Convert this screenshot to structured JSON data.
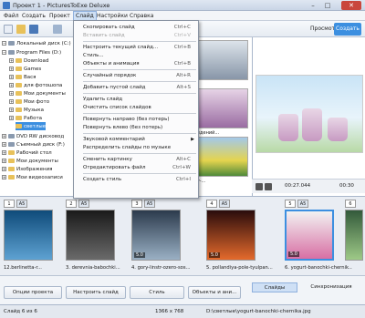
{
  "window": {
    "title": "Проект 1 - PicturesToExe Deluxe",
    "minimize": "–",
    "maximize": "□",
    "close": "✕"
  },
  "menubar": [
    {
      "label": "Файл"
    },
    {
      "label": "Создать"
    },
    {
      "label": "Проект"
    },
    {
      "label": "Слайд"
    },
    {
      "label": "Настройки"
    },
    {
      "label": "Справка"
    }
  ],
  "toolbar": {
    "preview_label": "Просмотр",
    "create_label": "Создать"
  },
  "tree": [
    {
      "label": "Локальный диск (C:)",
      "exp": "−",
      "type": "drive"
    },
    {
      "label": "Program Files (D:)",
      "exp": "−",
      "type": "drive"
    },
    {
      "label": "Download",
      "exp": "+",
      "type": "folder"
    },
    {
      "label": "Games",
      "exp": "+",
      "type": "folder"
    },
    {
      "label": "Вася",
      "exp": "+",
      "type": "folder"
    },
    {
      "label": "для фотошопа",
      "exp": "+",
      "type": "folder"
    },
    {
      "label": "Мои документы",
      "exp": "+",
      "type": "folder"
    },
    {
      "label": "Мои фото",
      "exp": "+",
      "type": "folder"
    },
    {
      "label": "Музыка",
      "exp": "+",
      "type": "folder"
    },
    {
      "label": "Работа",
      "exp": "+",
      "type": "folder"
    },
    {
      "label": "светлые",
      "exp": "",
      "type": "folder",
      "selected": true
    },
    {
      "label": "DVD RW дисковод",
      "exp": "+",
      "type": "drive"
    },
    {
      "label": "Съемный диск (F:)",
      "exp": "+",
      "type": "drive"
    },
    {
      "label": "Рабочий стол",
      "exp": "+",
      "type": "folder"
    },
    {
      "label": "Мои документы",
      "exp": "+",
      "type": "folder"
    },
    {
      "label": "Изображения",
      "exp": "+",
      "type": "folder"
    },
    {
      "label": "Мои видеозаписи",
      "exp": "+",
      "type": "folder"
    }
  ],
  "top_thumbs": [
    {
      "caption": "fdk..."
    },
    {
      "caption": "...ых сведений..."
    },
    {
      "caption": "tyulpany-...",
      "tooltip": "tyulpany-"
    }
  ],
  "player": {
    "time_current": "00:27.044",
    "time_total": "00:30"
  },
  "dropdown": {
    "items": [
      {
        "label": "Скопировать слайд",
        "shortcut": "Ctrl+C",
        "disabled": false
      },
      {
        "label": "Вставить слайд",
        "shortcut": "Ctrl+V",
        "disabled": true
      },
      {
        "sep": true
      },
      {
        "label": "Настроить текущий слайд...",
        "shortcut": "Ctrl+B",
        "disabled": false
      },
      {
        "label": "Стиль...",
        "shortcut": "",
        "disabled": false
      },
      {
        "label": "Объекты и анимация",
        "shortcut": "Ctrl+B",
        "disabled": false
      },
      {
        "sep": true
      },
      {
        "label": "Случайный порядок",
        "shortcut": "Alt+R",
        "disabled": false
      },
      {
        "sep": true
      },
      {
        "label": "Добавить пустой слайд",
        "shortcut": "Alt+S",
        "disabled": false
      },
      {
        "sep": true
      },
      {
        "label": "Удалить слайд",
        "shortcut": "",
        "disabled": false
      },
      {
        "label": "Очистить список слайдов",
        "shortcut": "",
        "disabled": false
      },
      {
        "sep": true
      },
      {
        "label": "Повернуть направо (без потерь)",
        "shortcut": "",
        "disabled": false
      },
      {
        "label": "Повернуть влево (без потерь)",
        "shortcut": "",
        "disabled": false
      },
      {
        "sep": true
      },
      {
        "label": "Звуковой комментарий",
        "shortcut": "",
        "disabled": false,
        "submenu": true
      },
      {
        "label": "Распределить слайды по музыке",
        "shortcut": "",
        "disabled": false
      },
      {
        "sep": true
      },
      {
        "label": "Сменить картинку",
        "shortcut": "Alt+C",
        "disabled": false
      },
      {
        "label": "Отредактировать файл",
        "shortcut": "Ctrl+W",
        "disabled": false
      },
      {
        "sep": true
      },
      {
        "label": "Создать стиль",
        "shortcut": "Ctrl+I",
        "disabled": false
      }
    ]
  },
  "slides": [
    {
      "num": "1",
      "duration": "A5",
      "caption": "12.berlinetta-r...",
      "badge": "",
      "colors": [
        "#0f4b7a",
        "#5ea2d2"
      ]
    },
    {
      "num": "2",
      "duration": "A5",
      "caption": "3. derevnia-babochki...",
      "badge": "",
      "colors": [
        "#1a1a1a",
        "#6a6a6a"
      ]
    },
    {
      "num": "3",
      "duration": "A5",
      "caption": "4. gory-linstr-ozero-sos...",
      "badge": "5.0",
      "colors": [
        "#2c3b4d",
        "#9ab0c4"
      ]
    },
    {
      "num": "4",
      "duration": "A5",
      "caption": "5. pollandiya-pole-tyulpan...",
      "badge": "5.0",
      "colors": [
        "#2a0c0c",
        "#e46a2c"
      ]
    },
    {
      "num": "5",
      "duration": "A5",
      "caption": "6. yogurt-banochki-chernik...",
      "badge": "5.0",
      "colors": [
        "#f2f2f2",
        "#d86fa4"
      ],
      "selected": true
    },
    {
      "num": "6",
      "duration": "A5",
      "caption": "",
      "badge": "",
      "colors": [
        "#335a3b",
        "#9ec987"
      ]
    }
  ],
  "bottom_buttons": [
    {
      "label": "Опции проекта"
    },
    {
      "label": "Настроить слайд"
    },
    {
      "label": "Стиль"
    },
    {
      "label": "Объекты и ани..."
    }
  ],
  "right_tabs": [
    {
      "label": "Слайды",
      "active": true
    },
    {
      "label": "Синхронизация",
      "active": false
    }
  ],
  "status": {
    "slide_of": "Слайд 6 из 6",
    "resolution": "1366 x 768",
    "path": "D:\\светлые\\yogurt-banochki-chernika.jpg"
  },
  "colors": {
    "accent": "#3c8fe0",
    "selection": "#cfe0f5"
  }
}
